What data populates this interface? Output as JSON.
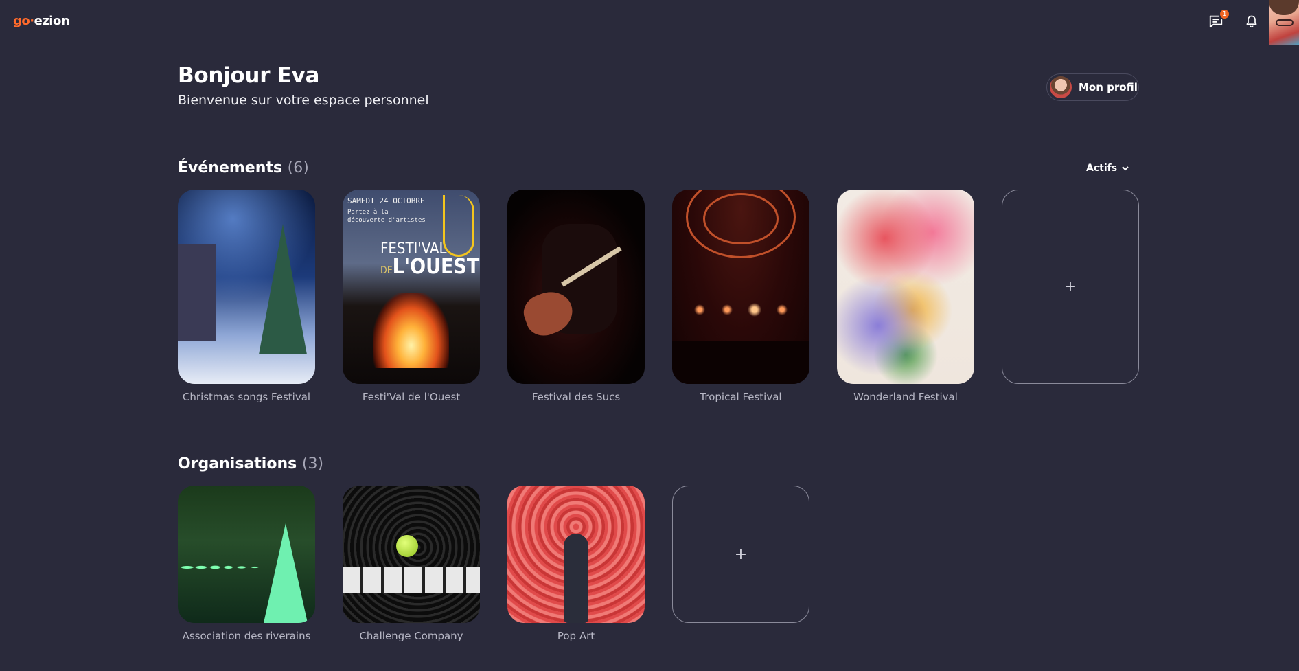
{
  "app": {
    "logo_go": "go",
    "logo_sep": "·",
    "logo_rest": "ezion",
    "messages_badge": "1"
  },
  "greeting": {
    "title": "Bonjour Eva",
    "subtitle": "Bienvenue sur votre espace personnel"
  },
  "profile_button": {
    "label": "Mon profil"
  },
  "events": {
    "title": "Événements",
    "count": "(6)",
    "filter_label": "Actifs",
    "items": [
      {
        "label": "Christmas songs Festival"
      },
      {
        "label": "Festi'Val de l'Ouest"
      },
      {
        "label": "Festival des Sucs"
      },
      {
        "label": "Tropical Festival"
      },
      {
        "label": "Wonderland Festival"
      }
    ],
    "add_symbol": "+"
  },
  "poster": {
    "date_line": "SAMEDI 24 OCTOBRE",
    "line1": "Partez à la",
    "line2": "découverte d'artistes",
    "title_top": "FESTI'VAL",
    "title_de": "DE",
    "title_bottom": "L'OUEST"
  },
  "organisations": {
    "title": "Organisations",
    "count": "(3)",
    "items": [
      {
        "label": "Association des riverains"
      },
      {
        "label": "Challenge Company"
      },
      {
        "label": "Pop Art"
      }
    ],
    "add_symbol": "+"
  },
  "colors": {
    "background": "#2a2a3b",
    "accent": "#ff6a2b",
    "badge": "#f26522"
  }
}
